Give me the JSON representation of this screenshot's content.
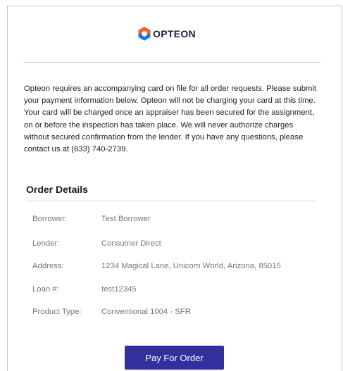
{
  "brand": {
    "name": "OPTEON",
    "logo_icon": "opteon-hexagon-icon",
    "logo_colors": [
      "#f26522",
      "#1a73e8"
    ]
  },
  "intro_text": "Opteon requires an accompanying card on file for all order requests. Please submit your payment information below. Opteon will not be charging your card at this time. Your card will be charged once an appraiser has been secured for the assignment, on or before the inspection has taken place. We will never authorize charges without secured confirmation from the lender. If you have any questions, please contact us at (833) 740-2739.",
  "order_details": {
    "title": "Order Details",
    "rows": [
      {
        "label": "Borrower:",
        "value": "Test Borrower"
      },
      {
        "label": "Lender:",
        "value": "Consumer Direct"
      },
      {
        "label": "Address:",
        "value": "1234 Magical Lane, Unicorn World, Arizona, 85015"
      },
      {
        "label": "Loan #:",
        "value": "test12345"
      },
      {
        "label": "Product Type:",
        "value": "Conventional 1004 - SFR"
      }
    ]
  },
  "actions": {
    "pay_label": "Pay For Order",
    "pay_color": "#32309e"
  }
}
